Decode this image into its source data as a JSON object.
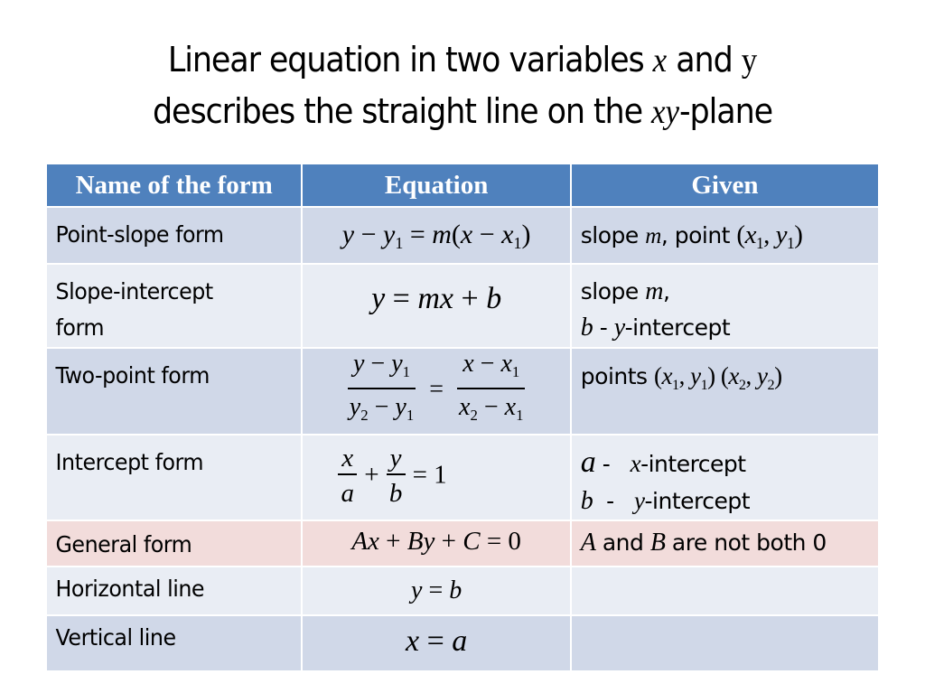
{
  "title": {
    "line1_pre": "Linear equation in two variables ",
    "line1_var_x": "x",
    "line1_mid": " and ",
    "line1_var_y": "y",
    "line2_pre": "describes the straight line on the ",
    "line2_var_xy": "xy",
    "line2_post": "-plane"
  },
  "table": {
    "headers": [
      "Name of the form",
      "Equation",
      "Given"
    ],
    "colors": {
      "header_bg": "#4f81bd",
      "row_dark": "#d0d8e8",
      "row_light": "#e9edf4",
      "row_highlight": "#f2dcdb"
    },
    "rows": [
      {
        "name": "Point-slope form",
        "equation": "y − y₁ = m(x − x₁)",
        "eq_parts": {
          "a": "y",
          "b": " − ",
          "c": "y",
          "d": "1",
          "e": " = ",
          "f": "m",
          "g": "(",
          "h": "x",
          "i": " − ",
          "j": "x",
          "k": "1",
          "l": ")"
        },
        "given": "slope m, point (x₁, y₁)",
        "given_parts": {
          "a": "slope ",
          "b": "m",
          "c": ", point ",
          "d": "(",
          "e": "x",
          "f": "1",
          "g": ", ",
          "h": "y",
          "i": "1",
          "j": ")"
        }
      },
      {
        "name_line1": "Slope-intercept",
        "name_line2": "form",
        "equation": "y = mx + b",
        "eq_parts": {
          "a": "y",
          "b": " = ",
          "c": "mx",
          "d": " + ",
          "e": "b"
        },
        "given": "slope m, b - y-intercept",
        "given_parts": {
          "a": "slope ",
          "b": "m",
          "c": ",",
          "d": "b",
          "e": " -  ",
          "f": "y",
          "g": "-intercept"
        }
      },
      {
        "name": "Two-point  form",
        "equation": "(y − y₁)/(y₂ − y₁) = (x − x₁)/(x₂ − x₁)",
        "eq_parts": {
          "n1a": "y",
          "n1b": " − ",
          "n1c": "y",
          "n1d": "1",
          "d1a": "y",
          "d1b": "2",
          "d1c": " − ",
          "d1d": "y",
          "d1e": "1",
          "eq": " = ",
          "n2a": "x",
          "n2b": " − ",
          "n2c": "x",
          "n2d": "1",
          "d2a": "x",
          "d2b": "2",
          "d2c": " − ",
          "d2d": "x",
          "d2e": "1"
        },
        "given": "points (x₁, y₁) (x₂, y₂)",
        "given_parts": {
          "a": "points ",
          "b": "(",
          "c": "x",
          "d": "1",
          "e": ", ",
          "f": "y",
          "g": "1",
          "h": ") (",
          "i": "x",
          "j": "2",
          "k": ", ",
          "l": "y",
          "m": "2",
          "n": ")"
        }
      },
      {
        "name": "Intercept  form",
        "equation": "x/a + y/b = 1",
        "eq_parts": {
          "n1": "x",
          "d1": "a",
          "plus": " + ",
          "n2": "y",
          "d2": "b",
          "rhs": " = 1"
        },
        "given": "a - x-intercept; b - y-intercept",
        "given_parts": {
          "a": "a",
          "b": " -   ",
          "c": "x",
          "d": "-intercept",
          "e": "b",
          "f": "  -   ",
          "g": "y",
          "h": "-intercept"
        }
      },
      {
        "name": "General form",
        "equation": "Ax + By + C = 0",
        "eq_parts": {
          "a": "Ax",
          "b": " + ",
          "c": "By",
          "d": " + ",
          "e": "C",
          "f": " = 0"
        },
        "given": "A and B are not both 0",
        "given_parts": {
          "a": "A",
          "b": " and ",
          "c": "B",
          "d": " are not both 0"
        }
      },
      {
        "name": "Horizontal  line",
        "equation": "y = b",
        "eq_parts": {
          "a": "y",
          "b": " = ",
          "c": "b"
        },
        "given": ""
      },
      {
        "name": "Vertical  line",
        "equation": "x = a",
        "eq_parts": {
          "a": "x",
          "b": " = ",
          "c": "a"
        },
        "given": ""
      }
    ]
  }
}
